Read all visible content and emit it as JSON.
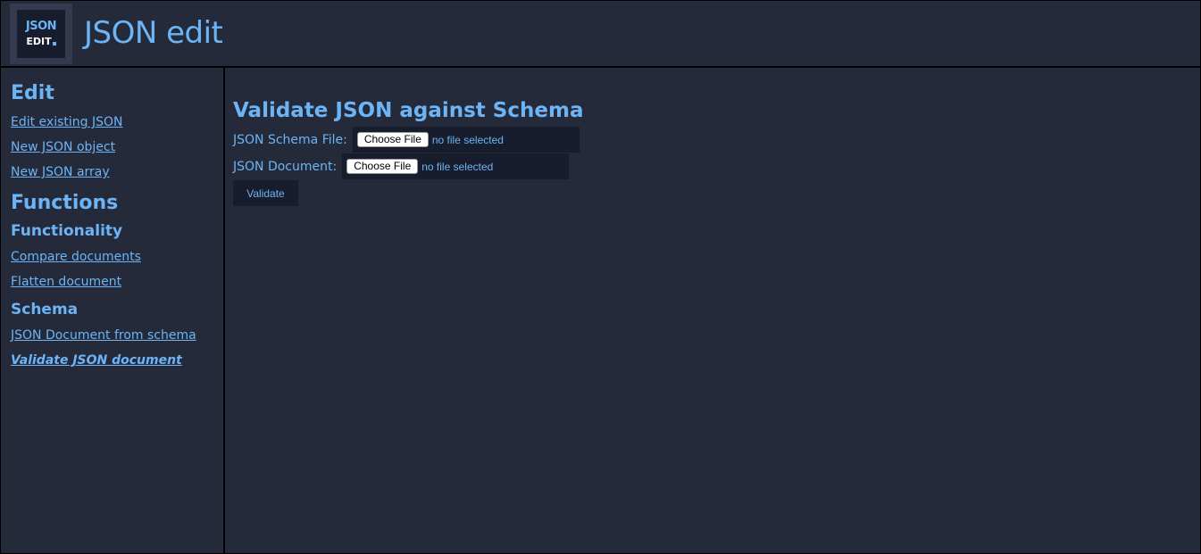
{
  "header": {
    "logo": {
      "line1": "JSON",
      "line2": "EDIT"
    },
    "title": "JSON edit"
  },
  "sidebar": {
    "edit_heading": "Edit",
    "edit_links": [
      "Edit existing JSON",
      "New JSON object",
      "New JSON array"
    ],
    "functions_heading": "Functions",
    "functionality_heading": "Functionality",
    "functionality_links": [
      "Compare documents",
      "Flatten document"
    ],
    "schema_heading": "Schema",
    "schema_links": [
      "JSON Document from schema",
      "Validate JSON document"
    ],
    "active_link": "Validate JSON document"
  },
  "main": {
    "title": "Validate JSON against Schema",
    "schema_file": {
      "label": "JSON Schema File:",
      "button": "Choose File",
      "status": "no file selected"
    },
    "document_file": {
      "label": "JSON Document:",
      "button": "Choose File",
      "status": "no file selected"
    },
    "validate_button": "Validate"
  },
  "colors": {
    "background": "#242a3a",
    "accent": "#6cb4f5",
    "input_background": "#171d2c"
  }
}
